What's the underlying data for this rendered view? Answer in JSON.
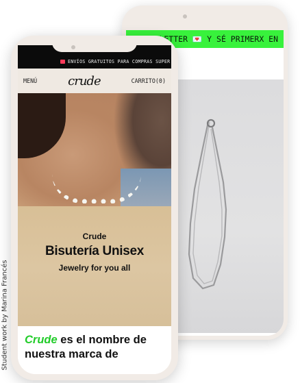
{
  "credit": "Student work by Marina Francés",
  "back_phone": {
    "ticker_text": "RA NEWSLETTER 💌 Y SÉ PRIMERX EN",
    "photo_icon": "necklace-photo"
  },
  "front_phone": {
    "shipping_bar": "ENVÍOS GRATUITOS PARA COMPRAS SUPER",
    "nav": {
      "menu": "MENÚ",
      "logo": "crude",
      "cart": "CARRITO(0)"
    },
    "hero": {
      "brand": "Crude",
      "title": "Bisutería Unisex",
      "subtitle": "Jewelry for you all"
    },
    "intro": {
      "brand": "Crude",
      "text": "es el nombre de nuestra marca de"
    }
  },
  "colors": {
    "accent_green": "#38f23c",
    "brand_green": "#22cc2a",
    "frame": "#f1ebe6"
  }
}
